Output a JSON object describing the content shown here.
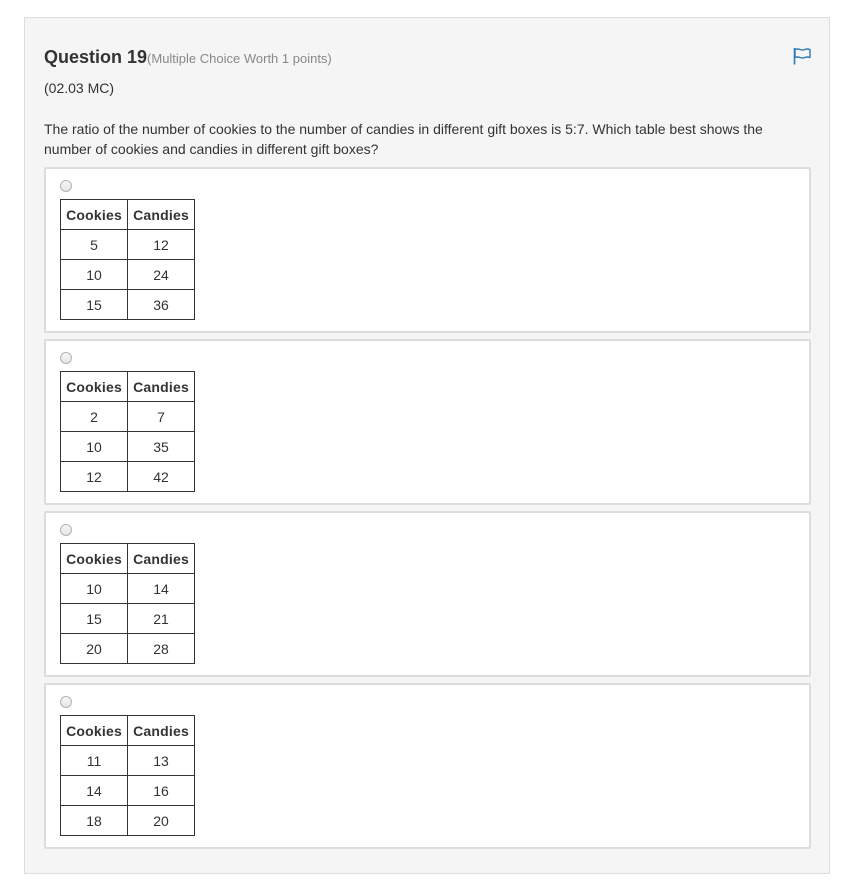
{
  "question": {
    "title": "Question 19",
    "worth": "(Multiple Choice Worth 1 points)",
    "code": "(02.03 MC)",
    "prompt": "The ratio of the number of cookies to the number of candies in different gift boxes is 5:7. Which table best shows the number of cookies and candies in different gift boxes?",
    "flag_icon": "flag-icon"
  },
  "table_headers": {
    "col1": "Cookies",
    "col2": "Candies"
  },
  "choices": [
    {
      "rows": [
        [
          "5",
          "12"
        ],
        [
          "10",
          "24"
        ],
        [
          "15",
          "36"
        ]
      ]
    },
    {
      "rows": [
        [
          "2",
          "7"
        ],
        [
          "10",
          "35"
        ],
        [
          "12",
          "42"
        ]
      ]
    },
    {
      "rows": [
        [
          "10",
          "14"
        ],
        [
          "15",
          "21"
        ],
        [
          "20",
          "28"
        ]
      ]
    },
    {
      "rows": [
        [
          "11",
          "13"
        ],
        [
          "14",
          "16"
        ],
        [
          "18",
          "20"
        ]
      ]
    }
  ],
  "colors": {
    "panel_bg": "#f5f5f5",
    "choice_border": "#dddddd",
    "flag": "#2b7bb9",
    "muted_text": "#888888"
  }
}
